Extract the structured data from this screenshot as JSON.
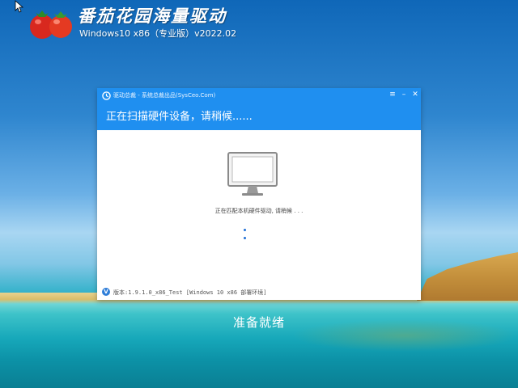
{
  "logo": {
    "title": "番茄花园海量驱动",
    "subtitle": "Windows10 x86（专业版）v2022.02"
  },
  "window": {
    "title": "驱动总裁 - 系统总裁出品(SysCeo.Com)",
    "heading": "正在扫描硬件设备，请稍候......",
    "controls": {
      "menu": "≡",
      "minimize": "–",
      "close": "✕"
    },
    "status": "正在匹配本机硬件驱动, 请稍候 . . .",
    "footer": "版本:1.9.1.0_x86_Test [Windows 10 x86 部署环境]",
    "footer_icon": "V"
  },
  "ready_text": "准备就绪",
  "colors": {
    "accent": "#1f8ff0",
    "spinner": "#1f6fd6"
  }
}
